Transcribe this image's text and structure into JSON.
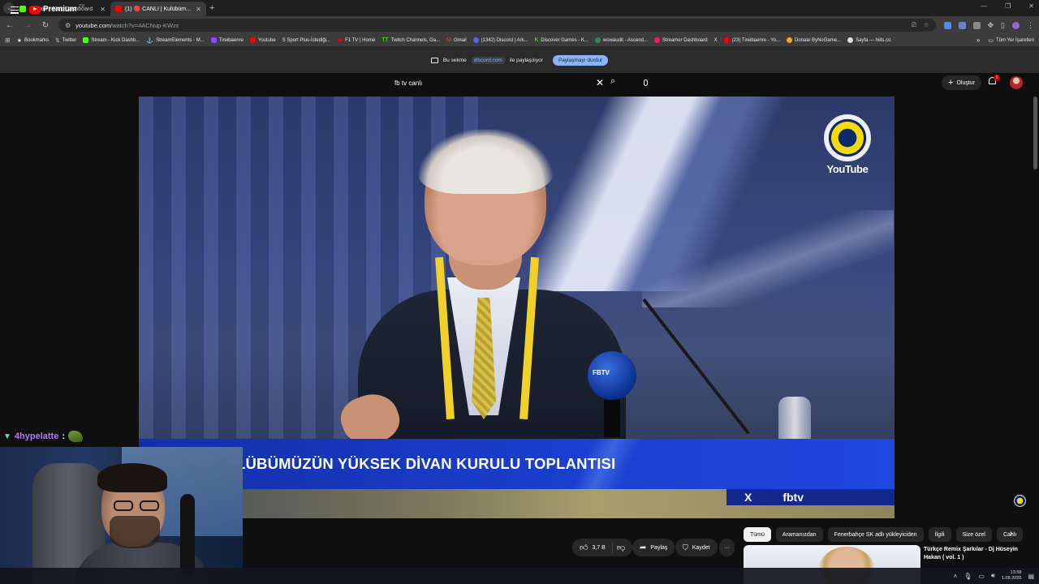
{
  "browser": {
    "tabs": [
      {
        "title": "Stream - Kick Dashboard",
        "favicon_color": "#53fc18",
        "active": false
      },
      {
        "title": "(1) 🔴 CANLI | Kulübümüzün",
        "favicon_color": "#ff0000",
        "active": true
      }
    ],
    "address": {
      "domain": "youtube.com",
      "path": "/watch?v=4ACNup-KWzc"
    },
    "bookmarks": [
      {
        "label": "Bookmarks",
        "color": "#f1f1f1"
      },
      {
        "label": "Twitter",
        "color": "#ffffff"
      },
      {
        "label": "Stream - Kick Dashb...",
        "color": "#53fc18"
      },
      {
        "label": "StreamElements - M...",
        "color": "#f1f1f1"
      },
      {
        "label": "Tireibaenre",
        "color": "#9146ff"
      },
      {
        "label": "Youtube",
        "color": "#ff0000"
      },
      {
        "label": "S Sport Plus-İstediği...",
        "color": "#f1f1f1"
      },
      {
        "label": "F1 TV | Home",
        "color": "#e10600"
      },
      {
        "label": "Twitch Channels, Ga...",
        "color": "#9146ff"
      },
      {
        "label": "Gmail",
        "color": "#ea4335"
      },
      {
        "label": "(1342) Discord | Ark...",
        "color": "#5865f2"
      },
      {
        "label": "Discover Games - K...",
        "color": "#53fc18"
      },
      {
        "label": "wowaudit - Ascend...",
        "color": "#2e8b57"
      },
      {
        "label": "Streamer Dashboard",
        "color": "#e91e63"
      },
      {
        "label": "X",
        "color": "#ffffff"
      },
      {
        "label": "(23) Tireibaenre - Yo...",
        "color": "#ff0000"
      },
      {
        "label": "Donate ByNoGame...",
        "color": "#f5a623"
      },
      {
        "label": "Sayfa — hiits.co",
        "color": "#ffffff"
      }
    ],
    "bookmarks_overflow": "»",
    "all_bookmarks": "Tüm Yer İşaretleri"
  },
  "share_bar": {
    "prefix": "Bu sekme",
    "host": "discord.com",
    "suffix": "ile paylaşılıyor",
    "stop_label": "Paylaşmayı durdur"
  },
  "youtube": {
    "logo_text": "Premium",
    "country": "TR",
    "search_value": "fb tv canlı",
    "create_label": "Oluştur",
    "notification_count": "1",
    "player": {
      "watermark_text": "YouTube",
      "lower_third": "LÜBÜMÜZÜN YÜKSEK DİVAN KURULU TOPLANTISI",
      "tag_text": "fbtv",
      "tag_x": "X",
      "mic_logo": "FBTV"
    },
    "actions": {
      "like_count": "3,7 B",
      "share_label": "Paylaş",
      "save_label": "Kaydet",
      "more_label": "···"
    },
    "chips": [
      "Tümü",
      "Aramanızdan",
      "Fenerbahçe SK adlı yükleyiciden",
      "İlgili",
      "Size özel",
      "Canlı"
    ],
    "recommendation_title": "Türkçe Remix Şarkılar - Dj Hüseyin Hakan ( vol. 1 )"
  },
  "chat_overlay": {
    "user": "4hypelatte",
    "colon": ":"
  },
  "taskbar": {
    "time": "13:58",
    "date": "1.08.2026"
  }
}
